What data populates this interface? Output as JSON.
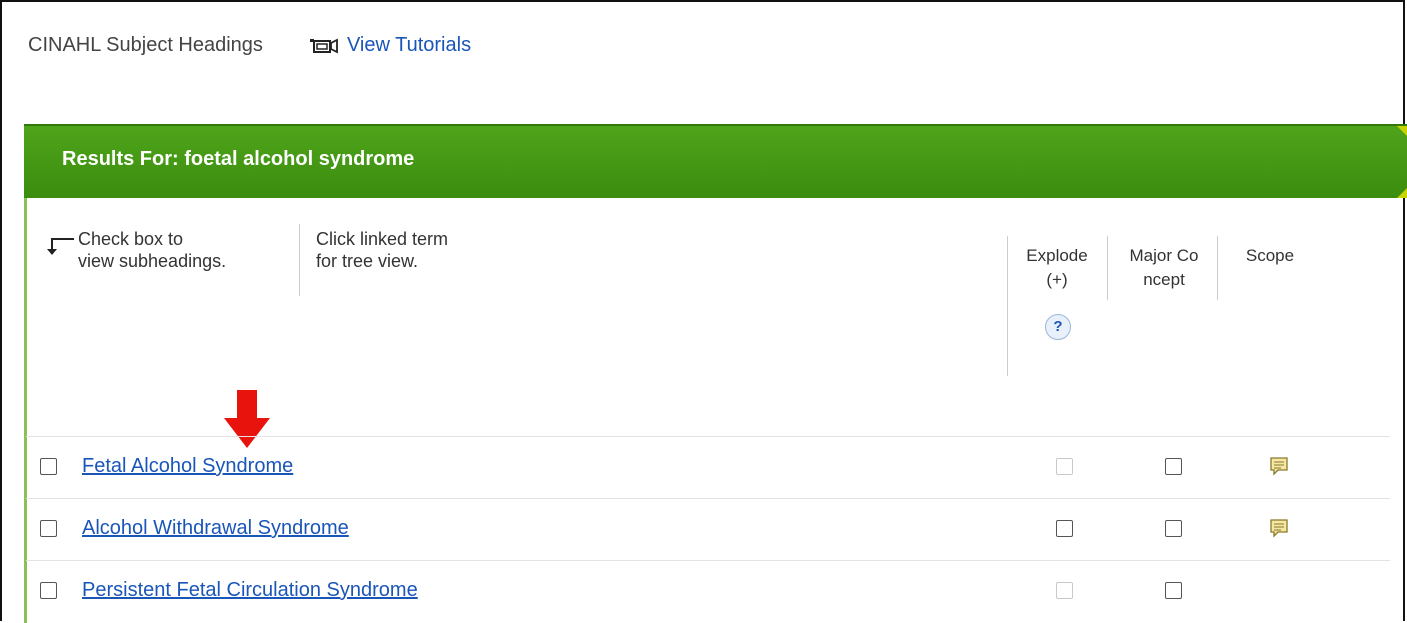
{
  "topbar": {
    "title": "CINAHL Subject Headings",
    "tutorial_icon": "video-camera-icon",
    "tutorial_link": "View Tutorials"
  },
  "results": {
    "header": "Results For: foetal alcohol syndrome"
  },
  "instructions": {
    "check_box_line1": "Check box to",
    "check_box_line2": "view subheadings.",
    "click_term_line1": "Click linked term",
    "click_term_line2": "for tree view."
  },
  "columns": {
    "explode_line1": "Explode",
    "explode_line2": "(+)",
    "major_line1": "Major Co",
    "major_line2": "ncept",
    "scope": "Scope",
    "help_icon": "help-icon"
  },
  "annotation": {
    "icon": "red-down-arrow-icon"
  },
  "rows": [
    {
      "term": "Fetal Alcohol Syndrome",
      "explode_enabled": false,
      "has_scope": true
    },
    {
      "term": "Alcohol Withdrawal Syndrome",
      "explode_enabled": true,
      "has_scope": true
    },
    {
      "term": "Persistent Fetal Circulation Syndrome",
      "explode_enabled": false,
      "has_scope": false
    }
  ],
  "colors": {
    "header_green": "#4fa41b",
    "link_blue": "#1a56b8",
    "annotation_red": "#e8130d",
    "panel_border": "#8bbf59"
  }
}
